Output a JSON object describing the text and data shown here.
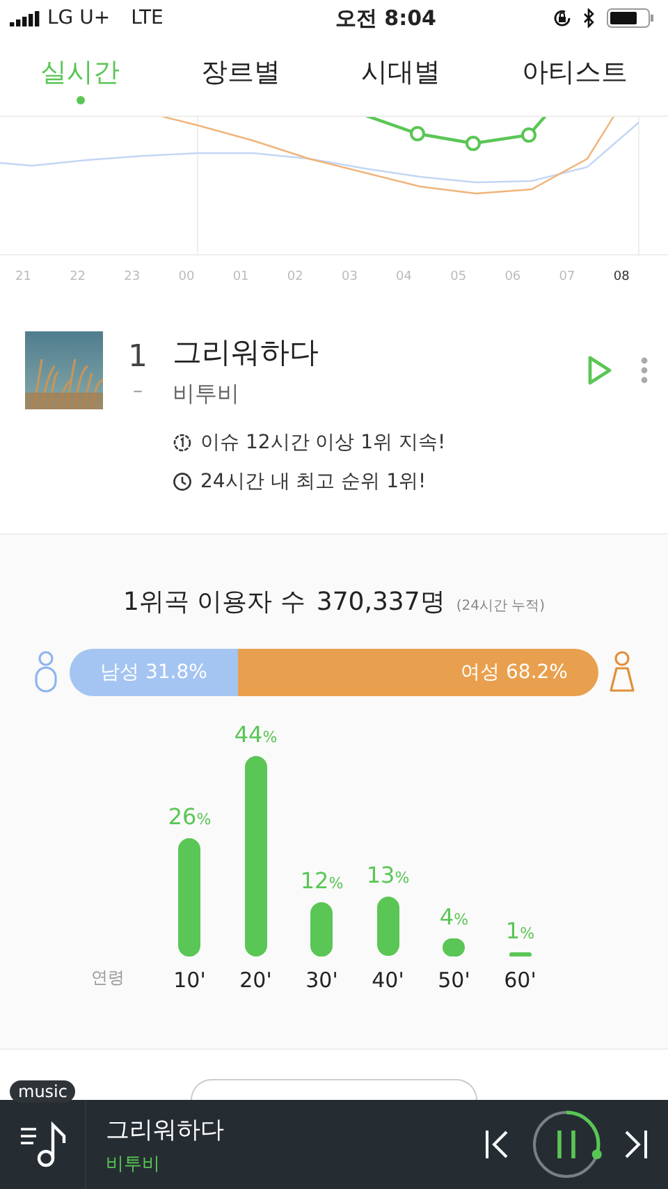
{
  "status_bar": {
    "carrier": "LG U+",
    "network": "LTE",
    "time": "오전 8:04"
  },
  "tabs": [
    {
      "label": "실시간",
      "selected": true
    },
    {
      "label": "장르별",
      "selected": false
    },
    {
      "label": "시대별",
      "selected": false
    },
    {
      "label": "아티스트",
      "selected": false
    }
  ],
  "trend_chart": {
    "hours": [
      {
        "label": "21",
        "selected": false
      },
      {
        "label": "22",
        "selected": false
      },
      {
        "label": "23",
        "selected": false
      },
      {
        "label": "00",
        "selected": false
      },
      {
        "label": "01",
        "selected": false
      },
      {
        "label": "02",
        "selected": false
      },
      {
        "label": "03",
        "selected": false
      },
      {
        "label": "04",
        "selected": false
      },
      {
        "label": "05",
        "selected": false
      },
      {
        "label": "06",
        "selected": false
      },
      {
        "label": "07",
        "selected": false
      },
      {
        "label": "08",
        "selected": true
      }
    ]
  },
  "top_song": {
    "rank": "1",
    "change": "–",
    "title": "그리워하다",
    "artist": "비투비",
    "notes": [
      {
        "kind": "issue",
        "text": "이슈 12시간 이상 1위 지속!"
      },
      {
        "kind": "clock",
        "text": "24시간 내 최고 순위 1위!"
      }
    ]
  },
  "stats": {
    "heading": "1위곡 이용자 수",
    "count": "370,337명",
    "period": "(24시간 누적)",
    "gender": {
      "male": {
        "label": "남성 31.8%"
      },
      "female": {
        "label": "여성 68.2%"
      }
    },
    "chart_data": {
      "type": "bar",
      "xlabel": "연령",
      "categories": [
        "10'",
        "20'",
        "30'",
        "40'",
        "50'",
        "60'"
      ],
      "values": [
        26,
        44,
        12,
        13,
        4,
        1
      ],
      "value_labels": [
        "26%",
        "44%",
        "12%",
        "13%",
        "4%",
        "1%"
      ]
    }
  },
  "player": {
    "badge": "music",
    "title": "그리워하다",
    "artist": "비투비"
  }
}
